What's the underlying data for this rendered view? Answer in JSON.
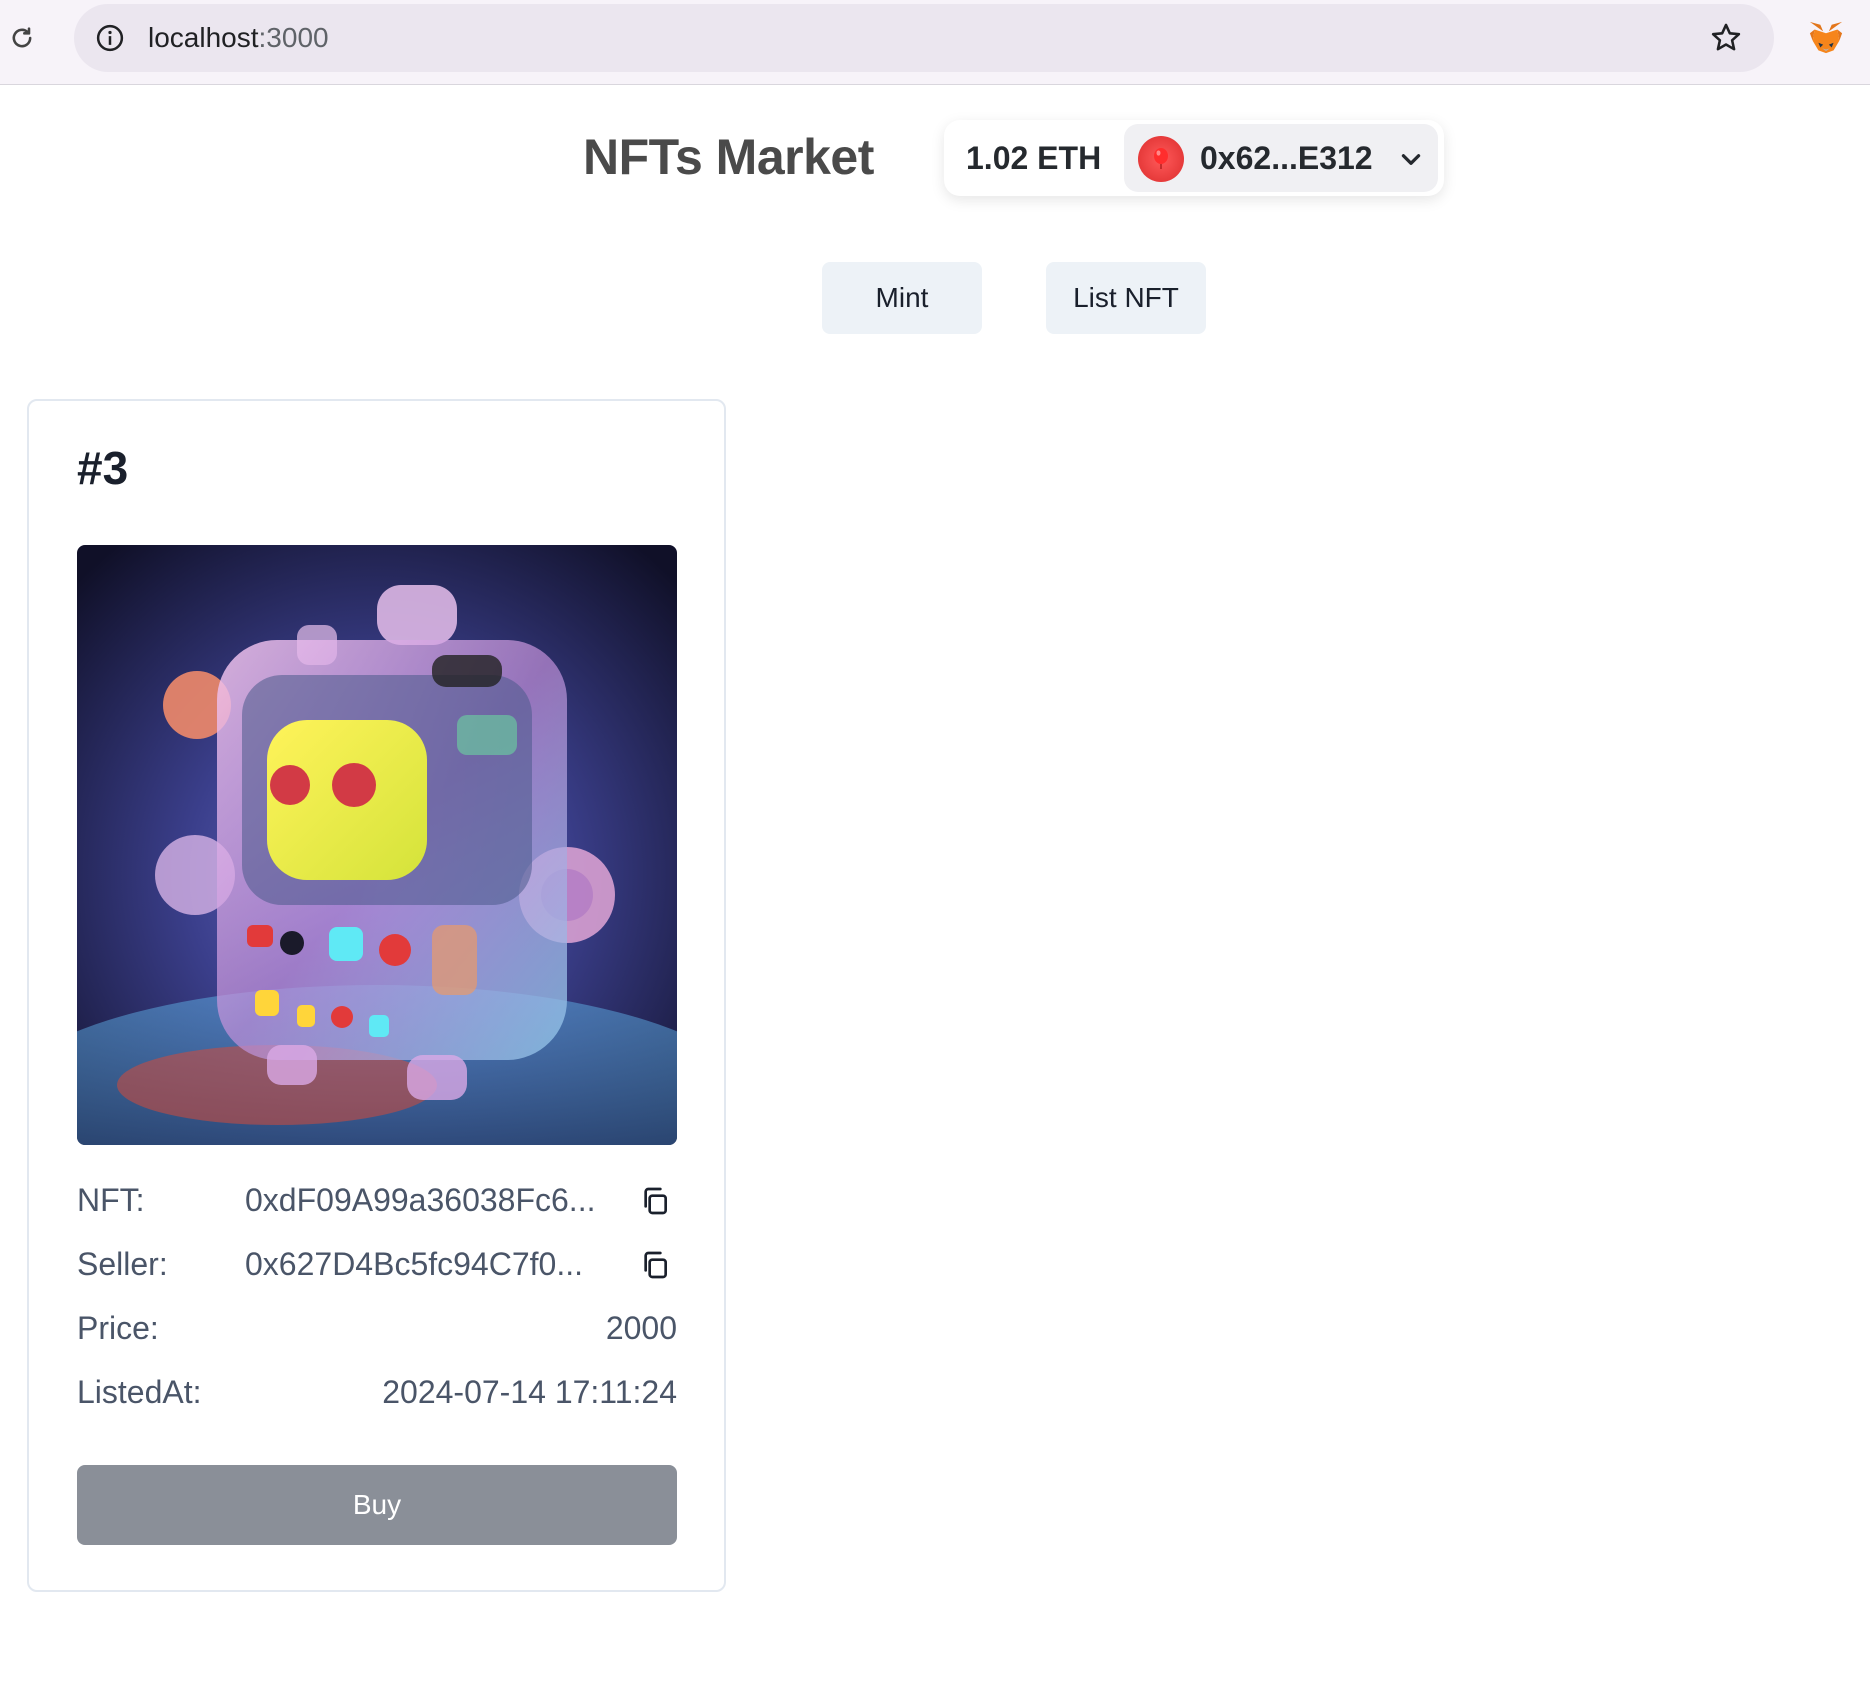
{
  "browser": {
    "url_host": "localhost",
    "url_port": ":3000"
  },
  "header": {
    "title": "NFTs Market",
    "wallet": {
      "balance": "1.02 ETH",
      "address": "0x62...E312"
    }
  },
  "actions": {
    "mint_label": "Mint",
    "list_label": "List NFT"
  },
  "listing": {
    "title": "#3",
    "fields": {
      "nft_label": "NFT:",
      "nft_value": "0xdF09A99a36038Fc6...",
      "seller_label": "Seller:",
      "seller_value": "0x627D4Bc5fc94C7f0...",
      "price_label": "Price:",
      "price_value": "2000",
      "listed_label": "ListedAt:",
      "listed_value": "2024-07-14 17:11:24"
    },
    "buy_label": "Buy"
  },
  "colors": {
    "buy_button": "#8a8f98",
    "action_button": "#edf2f7",
    "avatar": "#e63a3a"
  },
  "icons": [
    "reload-icon",
    "info-icon",
    "star-icon",
    "metamask-fox-icon",
    "chevron-down-icon",
    "copy-icon"
  ]
}
